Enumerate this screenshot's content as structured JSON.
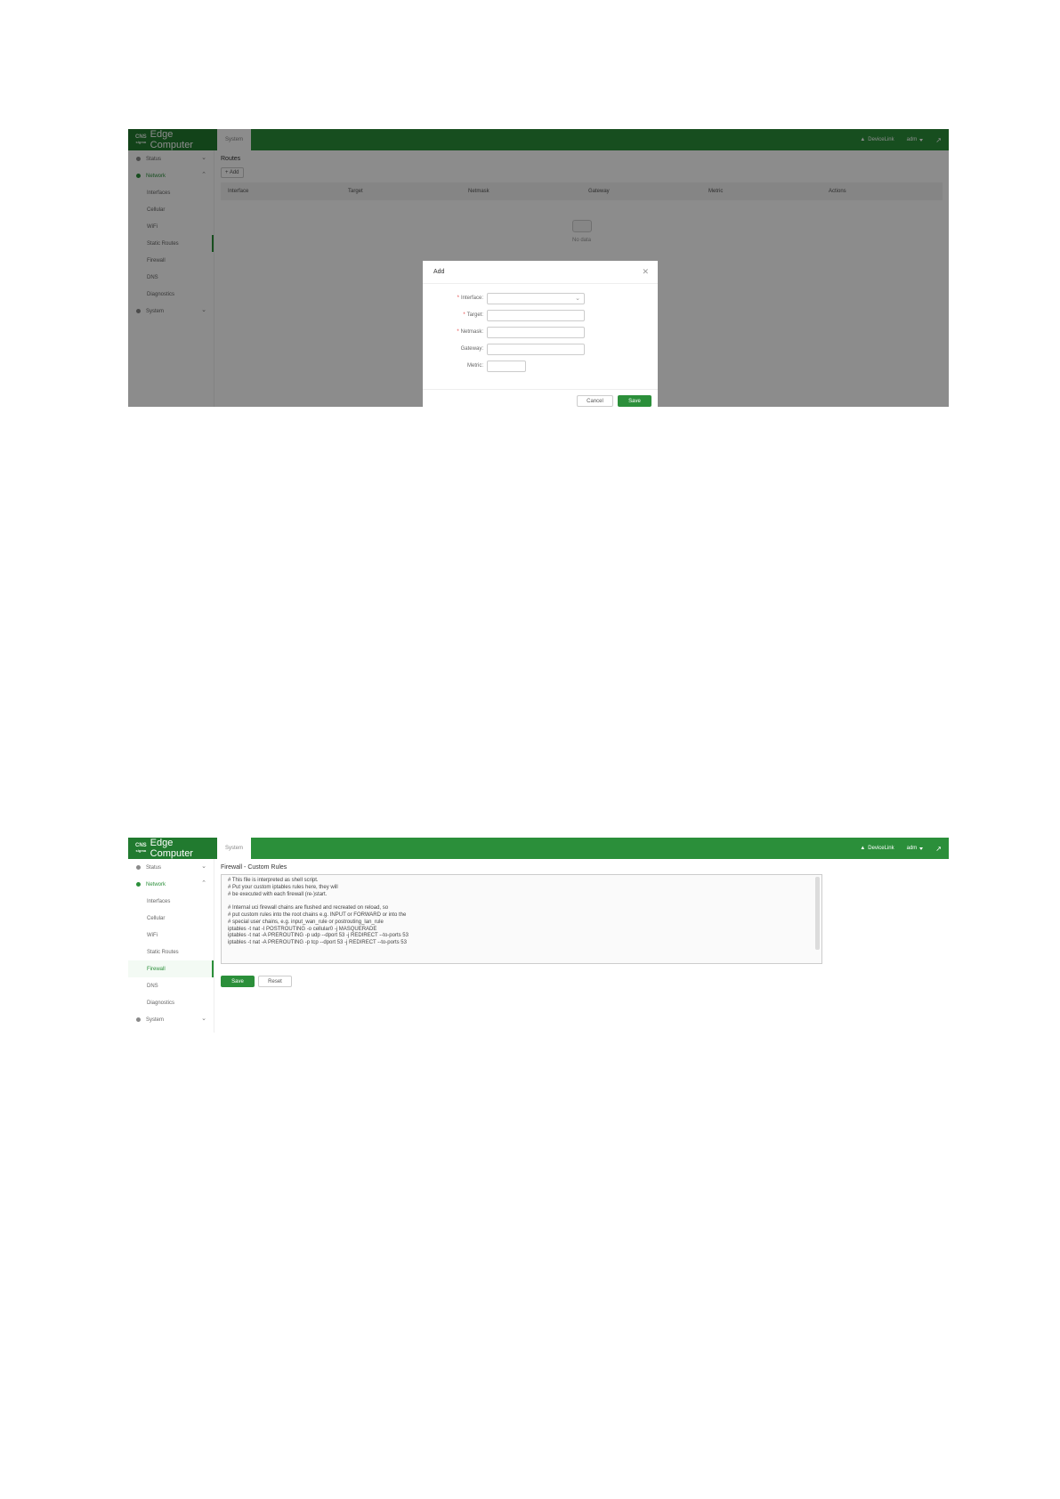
{
  "header": {
    "logo_mark": "CNS",
    "logo_sub": "sigma",
    "logo_title": "Edge Computer",
    "tab_label": "System",
    "device_link": "DeviceLink",
    "user": "adm",
    "external_icon": "external-link-icon"
  },
  "sidebar": {
    "status": "Status",
    "network": "Network",
    "system": "System",
    "items": [
      "Interfaces",
      "Cellular",
      "WiFi",
      "Static Routes",
      "Firewall",
      "DNS",
      "Diagnostics"
    ]
  },
  "routes": {
    "title": "Routes",
    "add_label": "+ Add",
    "columns": [
      "Interface",
      "Target",
      "Netmask",
      "Gateway",
      "Metric",
      "Actions"
    ],
    "empty": "No data"
  },
  "modal": {
    "title": "Add",
    "fields": {
      "interface": "Interface:",
      "target": "Target:",
      "netmask": "Netmask:",
      "gateway": "Gateway:",
      "metric": "Metric:"
    },
    "required_mark": "*",
    "cancel": "Cancel",
    "save": "Save"
  },
  "firewall": {
    "title": "Firewall - Custom Rules",
    "lines": [
      "# This file is interpreted as shell script.",
      "# Put your custom iptables rules here, they will",
      "# be executed with each firewall (re-)start.",
      "",
      "# Internal uci firewall chains are flushed and recreated on reload, so",
      "# put custom rules into the root chains e.g. INPUT or FORWARD or into the",
      "# special user chains, e.g. input_wan_rule or postrouting_lan_rule",
      "iptables -t nat -I POSTROUTING -o cellular0 -j MASQUERADE",
      "iptables -t nat -A PREROUTING -p udp --dport 53 -j REDIRECT --to-ports 53",
      "iptables -t nat -A PREROUTING -p tcp --dport 53 -j REDIRECT --to-ports 53"
    ],
    "save": "Save",
    "reset": "Reset"
  },
  "colors": {
    "brand_green": "#2b8f3a",
    "logo_green": "#217a2f",
    "overlay": "rgba(0,0,0,0.45)"
  }
}
